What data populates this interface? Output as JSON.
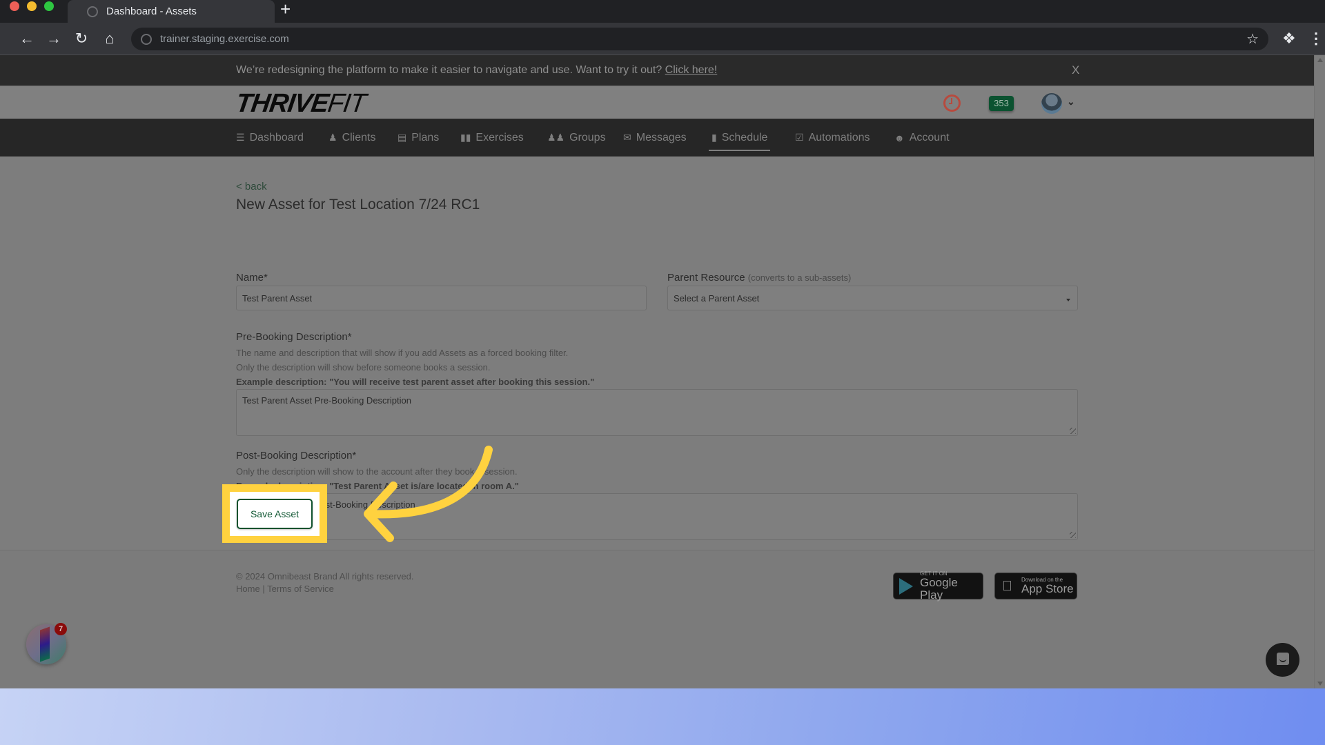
{
  "browser": {
    "tab_title": "Dashboard - Assets",
    "new_tab_label": "+",
    "url": "trainer.staging.exercise.com"
  },
  "banner": {
    "message": "We’re redesigning the platform to make it easier to navigate and use. Want to try it out?",
    "link_label": "Click here!",
    "close_label": "X"
  },
  "header": {
    "logo_bold": "THRIVE",
    "logo_light": "FIT",
    "notification_count": "353"
  },
  "nav": {
    "items": [
      {
        "label": "Dashboard",
        "icon": "list-icon",
        "active": false
      },
      {
        "label": "Clients",
        "icon": "user-icon",
        "active": false
      },
      {
        "label": "Plans",
        "icon": "clipboard-icon",
        "active": false
      },
      {
        "label": "Exercises",
        "icon": "dumbbell-icon",
        "active": false
      },
      {
        "label": "Groups",
        "icon": "group-icon",
        "active": false
      },
      {
        "label": "Messages",
        "icon": "envelope-icon",
        "active": false
      },
      {
        "label": "Schedule",
        "icon": "book-icon",
        "active": true
      },
      {
        "label": "Automations",
        "icon": "checkbox-icon",
        "active": false
      },
      {
        "label": "Account",
        "icon": "user-circle-icon",
        "active": false
      }
    ]
  },
  "form": {
    "back_label": "< back",
    "title": "New Asset for Test Location 7/24 RC1",
    "name_label": "Name*",
    "name_value": "Test Parent Asset",
    "parent_label": "Parent Resource",
    "parent_hint": "(converts to a sub-assets)",
    "parent_selected": "Select a Parent Asset",
    "pre_label": "Pre-Booking Description*",
    "pre_help_1": "The name and description that will show if you add Assets as a forced booking filter.",
    "pre_help_2": "Only the description will show before someone books a session.",
    "pre_example": "Example description: \"You will receive test parent asset after booking this session.\"",
    "pre_value": "Test Parent Asset Pre-Booking Description",
    "post_label": "Post-Booking Description*",
    "post_help": "Only the description will show to the account after they book a session.",
    "post_example": "Example description: \"Test Parent Asset is/are located in room A.\"",
    "post_value": "Test Parent Asset Post-Booking Description",
    "save_label": "Save Asset"
  },
  "footer": {
    "copyright": "© 2024 Omnibeast Brand All rights reserved.",
    "home_link": "Home",
    "separator": "|",
    "terms_link": "Terms of Service",
    "google_small": "GET IT ON",
    "google_big": "Google Play",
    "apple_small": "Download on the",
    "apple_big": "App Store"
  },
  "widgets": {
    "badge_count": "7"
  },
  "colors": {
    "highlight": "#ffd23f",
    "save_button_border": "#10522d",
    "badge_green": "#0b5230",
    "clock_red": "#b74a3e"
  }
}
